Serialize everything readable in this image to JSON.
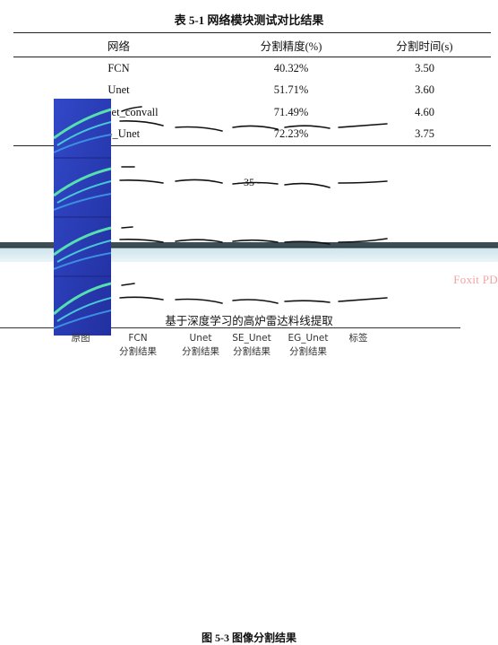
{
  "table": {
    "caption": "表 5-1  网络模块测试对比结果",
    "headers": [
      "网络",
      "分割精度(%)",
      "分割时间(s)"
    ],
    "rows": [
      [
        "FCN",
        "40.32%",
        "3.50"
      ],
      [
        "Unet",
        "51.71%",
        "3.60"
      ],
      [
        "SE_Unet_convall",
        "71.49%",
        "4.60"
      ],
      [
        "EG_Unet",
        "72.23%",
        "3.75"
      ]
    ]
  },
  "page_number": "- 35 -",
  "watermark": "Foxit PD",
  "running_header": "基于深度学习的高炉雷达料线提取",
  "figure": {
    "col_labels": [
      {
        "line1": "原图",
        "line2": ""
      },
      {
        "line1": "FCN",
        "line2": "分割结果"
      },
      {
        "line1": "Unet",
        "line2": "分割结果"
      },
      {
        "line1": "SE_Unet",
        "line2": "分割结果"
      },
      {
        "line1": "EG_Unet",
        "line2": "分割结果"
      },
      {
        "line1": "标签",
        "line2": ""
      }
    ],
    "caption": "图 5-3   图像分割结果"
  },
  "colors": {
    "original_bg": "#2a3fb8",
    "original_highlight": "#56e0b0",
    "line": "#111111",
    "watermark": "#f3a3a3"
  }
}
